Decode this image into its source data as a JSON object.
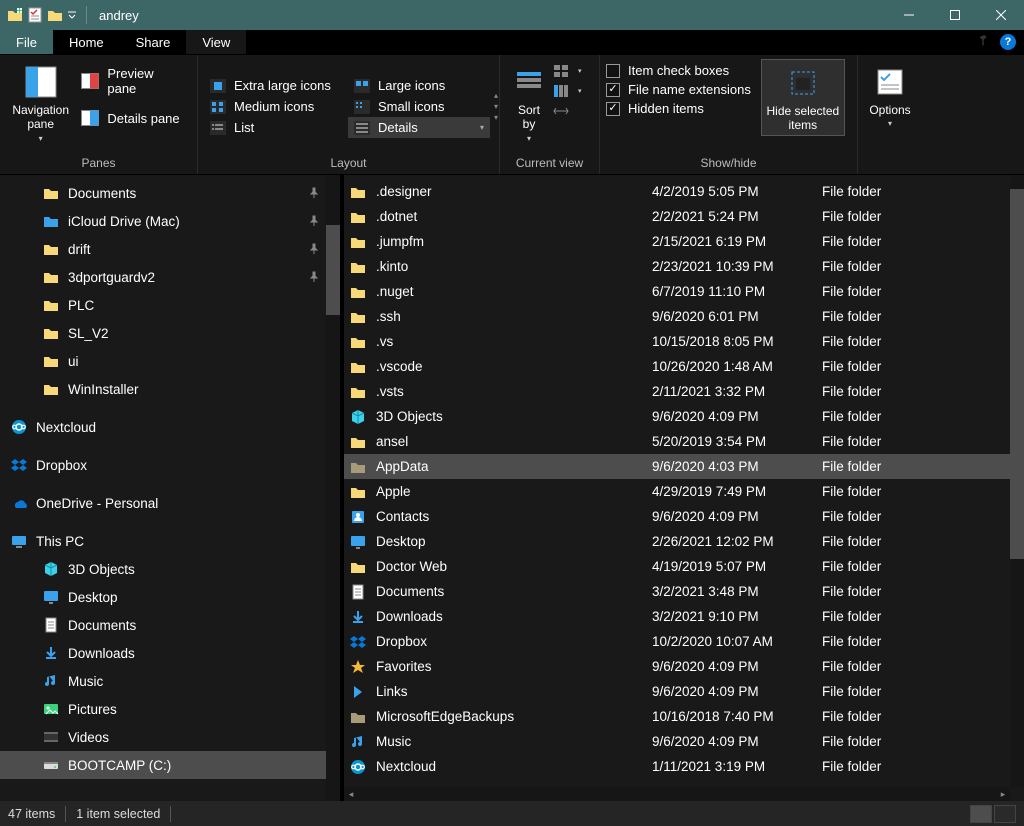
{
  "titlebar": {
    "title": "andrey"
  },
  "tabs": {
    "file": "File",
    "home": "Home",
    "share": "Share",
    "view": "View"
  },
  "ribbon": {
    "panes": {
      "group_label": "Panes",
      "navigation_pane": "Navigation\npane",
      "preview_pane": "Preview pane",
      "details_pane": "Details pane"
    },
    "layout": {
      "group_label": "Layout",
      "xl_icons": "Extra large icons",
      "l_icons": "Large icons",
      "m_icons": "Medium icons",
      "s_icons": "Small icons",
      "list": "List",
      "details": "Details"
    },
    "currentview": {
      "group_label": "Current view",
      "sort_by": "Sort\nby"
    },
    "showhide": {
      "group_label": "Show/hide",
      "item_checkboxes": "Item check boxes",
      "file_ext": "File name extensions",
      "hidden": "Hidden items",
      "hide_selected": "Hide selected\nitems"
    },
    "options": {
      "label": "Options"
    }
  },
  "navpane": {
    "items": [
      {
        "label": "Documents",
        "indent": 1,
        "icon": "folder",
        "pinned": true
      },
      {
        "label": "iCloud Drive (Mac)",
        "indent": 1,
        "icon": "folder-blue",
        "pinned": true
      },
      {
        "label": "drift",
        "indent": 1,
        "icon": "folder",
        "pinned": true
      },
      {
        "label": "3dportguardv2",
        "indent": 1,
        "icon": "folder",
        "pinned": true
      },
      {
        "label": "PLC",
        "indent": 1,
        "icon": "folder"
      },
      {
        "label": "SL_V2",
        "indent": 1,
        "icon": "folder"
      },
      {
        "label": "ui",
        "indent": 1,
        "icon": "folder"
      },
      {
        "label": "WinInstaller",
        "indent": 1,
        "icon": "folder"
      },
      {
        "spacer": true
      },
      {
        "label": "Nextcloud",
        "indent": 0,
        "icon": "nextcloud"
      },
      {
        "spacer": true
      },
      {
        "label": "Dropbox",
        "indent": 0,
        "icon": "dropbox"
      },
      {
        "spacer": true
      },
      {
        "label": "OneDrive - Personal",
        "indent": 0,
        "icon": "onedrive"
      },
      {
        "spacer": true
      },
      {
        "label": "This PC",
        "indent": 0,
        "icon": "thispc"
      },
      {
        "label": "3D Objects",
        "indent": 1,
        "icon": "cube"
      },
      {
        "label": "Desktop",
        "indent": 1,
        "icon": "desktop"
      },
      {
        "label": "Documents",
        "indent": 1,
        "icon": "docs"
      },
      {
        "label": "Downloads",
        "indent": 1,
        "icon": "download"
      },
      {
        "label": "Music",
        "indent": 1,
        "icon": "music"
      },
      {
        "label": "Pictures",
        "indent": 1,
        "icon": "pictures"
      },
      {
        "label": "Videos",
        "indent": 1,
        "icon": "videos"
      },
      {
        "label": "BOOTCAMP (C:)",
        "indent": 1,
        "icon": "drive",
        "selected": true
      }
    ]
  },
  "files": {
    "type_label": "File folder",
    "items": [
      {
        "name": ".designer",
        "date": "4/2/2019 5:05 PM",
        "icon": "folder"
      },
      {
        "name": ".dotnet",
        "date": "2/2/2021 5:24 PM",
        "icon": "folder"
      },
      {
        "name": ".jumpfm",
        "date": "2/15/2021 6:19 PM",
        "icon": "folder"
      },
      {
        "name": ".kinto",
        "date": "2/23/2021 10:39 PM",
        "icon": "folder"
      },
      {
        "name": ".nuget",
        "date": "6/7/2019 11:10 PM",
        "icon": "folder"
      },
      {
        "name": ".ssh",
        "date": "9/6/2020 6:01 PM",
        "icon": "folder"
      },
      {
        "name": ".vs",
        "date": "10/15/2018 8:05 PM",
        "icon": "folder"
      },
      {
        "name": ".vscode",
        "date": "10/26/2020 1:48 AM",
        "icon": "folder"
      },
      {
        "name": ".vsts",
        "date": "2/11/2021 3:32 PM",
        "icon": "folder"
      },
      {
        "name": "3D Objects",
        "date": "9/6/2020 4:09 PM",
        "icon": "cube"
      },
      {
        "name": "ansel",
        "date": "5/20/2019 3:54 PM",
        "icon": "folder"
      },
      {
        "name": "AppData",
        "date": "9/6/2020 4:03 PM",
        "icon": "folder-dim",
        "selected": true
      },
      {
        "name": "Apple",
        "date": "4/29/2019 7:49 PM",
        "icon": "folder"
      },
      {
        "name": "Contacts",
        "date": "9/6/2020 4:09 PM",
        "icon": "contacts"
      },
      {
        "name": "Desktop",
        "date": "2/26/2021 12:02 PM",
        "icon": "desktop"
      },
      {
        "name": "Doctor Web",
        "date": "4/19/2019 5:07 PM",
        "icon": "folder"
      },
      {
        "name": "Documents",
        "date": "3/2/2021 3:48 PM",
        "icon": "docs"
      },
      {
        "name": "Downloads",
        "date": "3/2/2021 9:10 PM",
        "icon": "download"
      },
      {
        "name": "Dropbox",
        "date": "10/2/2020 10:07 AM",
        "icon": "dropbox"
      },
      {
        "name": "Favorites",
        "date": "9/6/2020 4:09 PM",
        "icon": "favorites"
      },
      {
        "name": "Links",
        "date": "9/6/2020 4:09 PM",
        "icon": "links"
      },
      {
        "name": "MicrosoftEdgeBackups",
        "date": "10/16/2018 7:40 PM",
        "icon": "folder-dim"
      },
      {
        "name": "Music",
        "date": "9/6/2020 4:09 PM",
        "icon": "music"
      },
      {
        "name": "Nextcloud",
        "date": "1/11/2021 3:19 PM",
        "icon": "nextcloud"
      }
    ]
  },
  "statusbar": {
    "count": "47 items",
    "selected": "1 item selected"
  }
}
